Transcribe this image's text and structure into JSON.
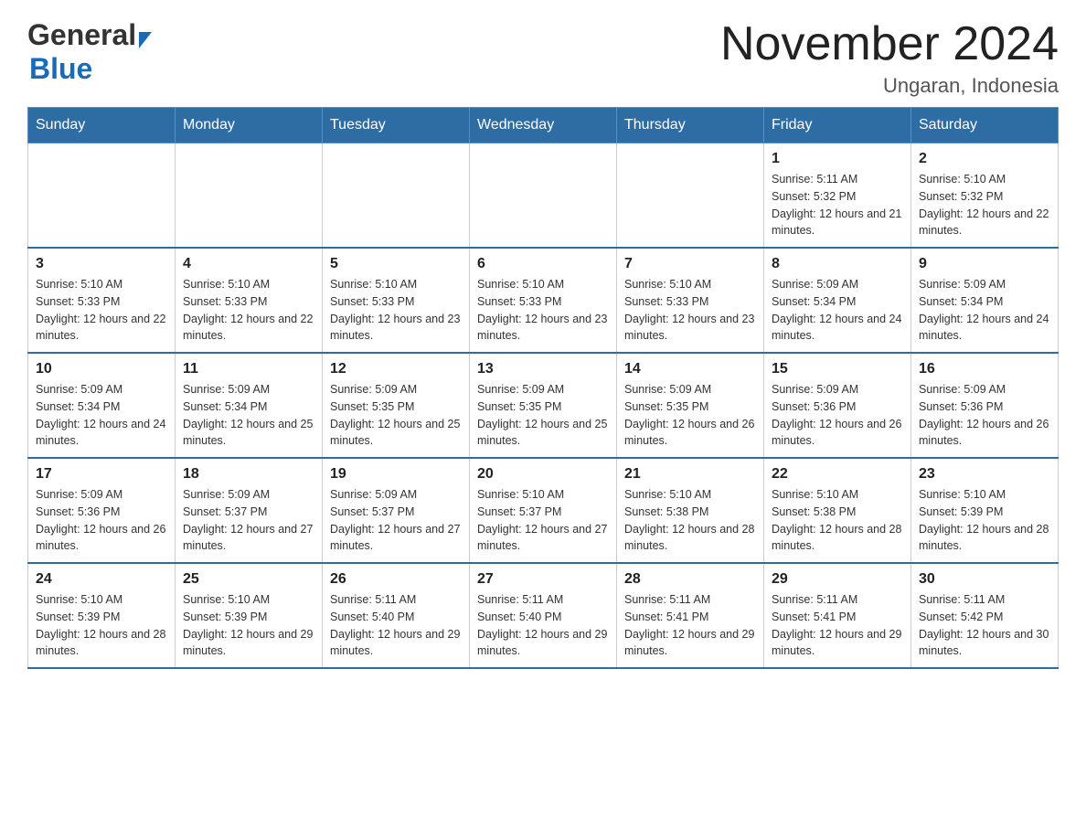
{
  "header": {
    "logo_general": "General",
    "logo_blue": "Blue",
    "title": "November 2024",
    "location": "Ungaran, Indonesia"
  },
  "days_of_week": [
    "Sunday",
    "Monday",
    "Tuesday",
    "Wednesday",
    "Thursday",
    "Friday",
    "Saturday"
  ],
  "weeks": [
    [
      {
        "day": "",
        "info": ""
      },
      {
        "day": "",
        "info": ""
      },
      {
        "day": "",
        "info": ""
      },
      {
        "day": "",
        "info": ""
      },
      {
        "day": "",
        "info": ""
      },
      {
        "day": "1",
        "info": "Sunrise: 5:11 AM\nSunset: 5:32 PM\nDaylight: 12 hours and 21 minutes."
      },
      {
        "day": "2",
        "info": "Sunrise: 5:10 AM\nSunset: 5:32 PM\nDaylight: 12 hours and 22 minutes."
      }
    ],
    [
      {
        "day": "3",
        "info": "Sunrise: 5:10 AM\nSunset: 5:33 PM\nDaylight: 12 hours and 22 minutes."
      },
      {
        "day": "4",
        "info": "Sunrise: 5:10 AM\nSunset: 5:33 PM\nDaylight: 12 hours and 22 minutes."
      },
      {
        "day": "5",
        "info": "Sunrise: 5:10 AM\nSunset: 5:33 PM\nDaylight: 12 hours and 23 minutes."
      },
      {
        "day": "6",
        "info": "Sunrise: 5:10 AM\nSunset: 5:33 PM\nDaylight: 12 hours and 23 minutes."
      },
      {
        "day": "7",
        "info": "Sunrise: 5:10 AM\nSunset: 5:33 PM\nDaylight: 12 hours and 23 minutes."
      },
      {
        "day": "8",
        "info": "Sunrise: 5:09 AM\nSunset: 5:34 PM\nDaylight: 12 hours and 24 minutes."
      },
      {
        "day": "9",
        "info": "Sunrise: 5:09 AM\nSunset: 5:34 PM\nDaylight: 12 hours and 24 minutes."
      }
    ],
    [
      {
        "day": "10",
        "info": "Sunrise: 5:09 AM\nSunset: 5:34 PM\nDaylight: 12 hours and 24 minutes."
      },
      {
        "day": "11",
        "info": "Sunrise: 5:09 AM\nSunset: 5:34 PM\nDaylight: 12 hours and 25 minutes."
      },
      {
        "day": "12",
        "info": "Sunrise: 5:09 AM\nSunset: 5:35 PM\nDaylight: 12 hours and 25 minutes."
      },
      {
        "day": "13",
        "info": "Sunrise: 5:09 AM\nSunset: 5:35 PM\nDaylight: 12 hours and 25 minutes."
      },
      {
        "day": "14",
        "info": "Sunrise: 5:09 AM\nSunset: 5:35 PM\nDaylight: 12 hours and 26 minutes."
      },
      {
        "day": "15",
        "info": "Sunrise: 5:09 AM\nSunset: 5:36 PM\nDaylight: 12 hours and 26 minutes."
      },
      {
        "day": "16",
        "info": "Sunrise: 5:09 AM\nSunset: 5:36 PM\nDaylight: 12 hours and 26 minutes."
      }
    ],
    [
      {
        "day": "17",
        "info": "Sunrise: 5:09 AM\nSunset: 5:36 PM\nDaylight: 12 hours and 26 minutes."
      },
      {
        "day": "18",
        "info": "Sunrise: 5:09 AM\nSunset: 5:37 PM\nDaylight: 12 hours and 27 minutes."
      },
      {
        "day": "19",
        "info": "Sunrise: 5:09 AM\nSunset: 5:37 PM\nDaylight: 12 hours and 27 minutes."
      },
      {
        "day": "20",
        "info": "Sunrise: 5:10 AM\nSunset: 5:37 PM\nDaylight: 12 hours and 27 minutes."
      },
      {
        "day": "21",
        "info": "Sunrise: 5:10 AM\nSunset: 5:38 PM\nDaylight: 12 hours and 28 minutes."
      },
      {
        "day": "22",
        "info": "Sunrise: 5:10 AM\nSunset: 5:38 PM\nDaylight: 12 hours and 28 minutes."
      },
      {
        "day": "23",
        "info": "Sunrise: 5:10 AM\nSunset: 5:39 PM\nDaylight: 12 hours and 28 minutes."
      }
    ],
    [
      {
        "day": "24",
        "info": "Sunrise: 5:10 AM\nSunset: 5:39 PM\nDaylight: 12 hours and 28 minutes."
      },
      {
        "day": "25",
        "info": "Sunrise: 5:10 AM\nSunset: 5:39 PM\nDaylight: 12 hours and 29 minutes."
      },
      {
        "day": "26",
        "info": "Sunrise: 5:11 AM\nSunset: 5:40 PM\nDaylight: 12 hours and 29 minutes."
      },
      {
        "day": "27",
        "info": "Sunrise: 5:11 AM\nSunset: 5:40 PM\nDaylight: 12 hours and 29 minutes."
      },
      {
        "day": "28",
        "info": "Sunrise: 5:11 AM\nSunset: 5:41 PM\nDaylight: 12 hours and 29 minutes."
      },
      {
        "day": "29",
        "info": "Sunrise: 5:11 AM\nSunset: 5:41 PM\nDaylight: 12 hours and 29 minutes."
      },
      {
        "day": "30",
        "info": "Sunrise: 5:11 AM\nSunset: 5:42 PM\nDaylight: 12 hours and 30 minutes."
      }
    ]
  ]
}
